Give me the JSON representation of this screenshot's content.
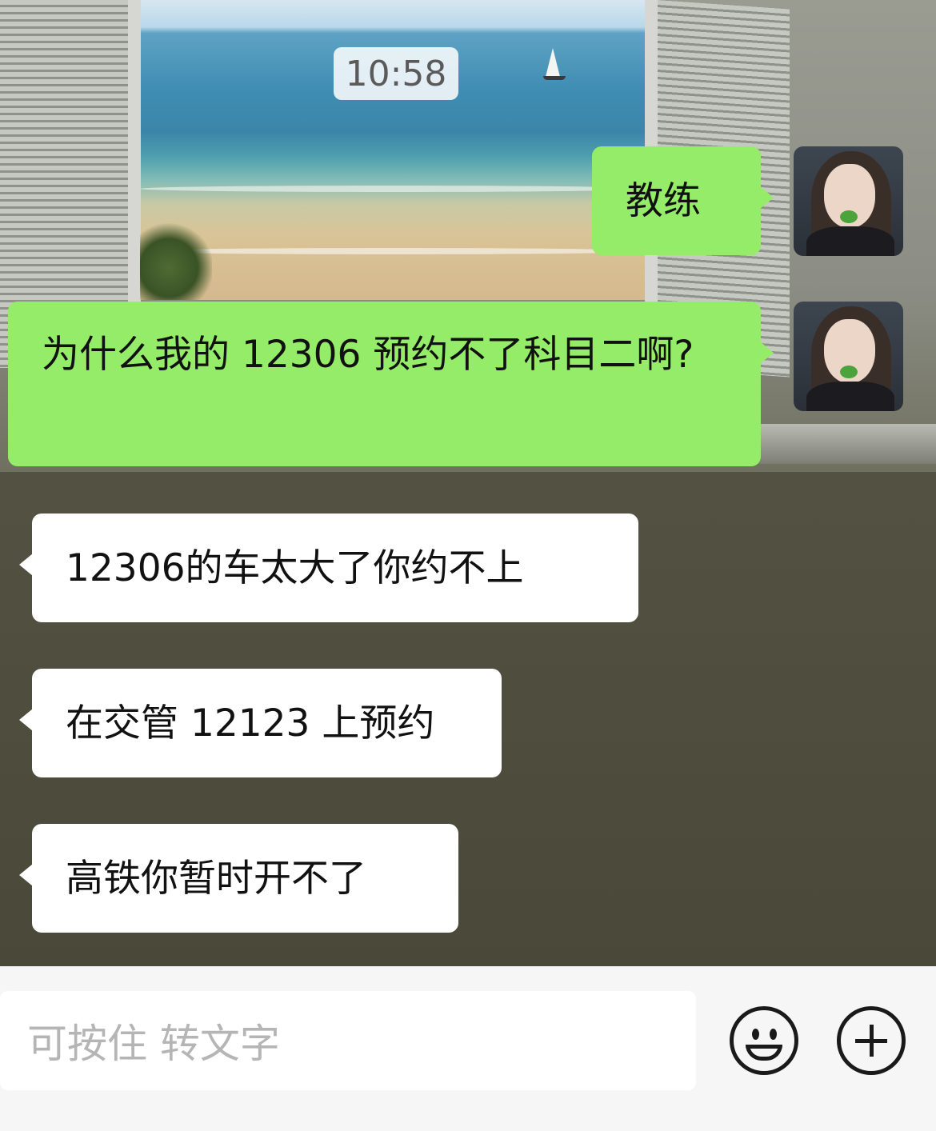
{
  "chat": {
    "timestamp": "10:58",
    "messages": [
      {
        "side": "sent",
        "text": "教练"
      },
      {
        "side": "sent",
        "text": "为什么我的 12306 预约不了科目二啊?"
      },
      {
        "side": "received",
        "text": "12306的车太大了你约不上"
      },
      {
        "side": "received",
        "text": "在交管 12123 上预约"
      },
      {
        "side": "received",
        "text": "高铁你暂时开不了"
      }
    ]
  },
  "input_bar": {
    "voice_placeholder": "可按住 转文字",
    "emoji_icon": "smiley-face-icon",
    "more_icon": "plus-circle-icon"
  },
  "colors": {
    "sent_bubble": "#95ec69",
    "received_bubble": "#ffffff",
    "input_bar_bg": "#f6f6f6"
  }
}
